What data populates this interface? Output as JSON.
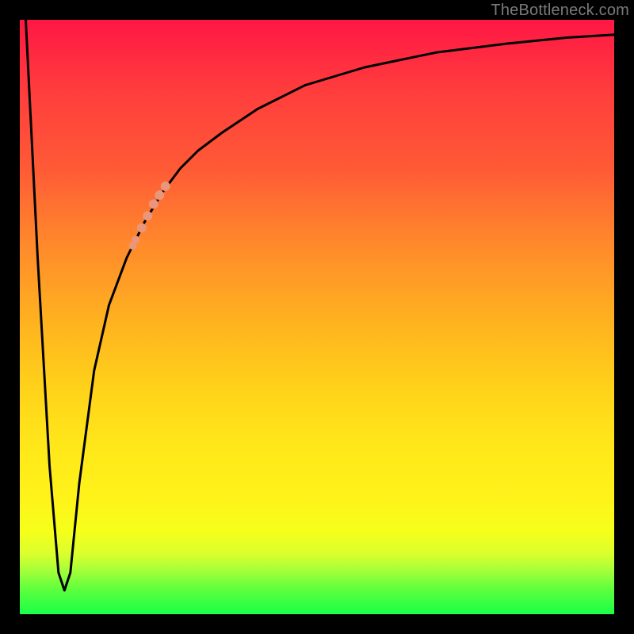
{
  "watermark": "TheBottleneck.com",
  "chart_data": {
    "type": "line",
    "title": "",
    "xlabel": "",
    "ylabel": "",
    "xlim": [
      0,
      100
    ],
    "ylim": [
      0,
      100
    ],
    "grid": false,
    "legend": false,
    "background_gradient_stops": [
      {
        "pos": 0,
        "color": "#ff1744"
      },
      {
        "pos": 12,
        "color": "#ff3d3d"
      },
      {
        "pos": 25,
        "color": "#ff5a36"
      },
      {
        "pos": 38,
        "color": "#ff8a2b"
      },
      {
        "pos": 50,
        "color": "#ffb020"
      },
      {
        "pos": 62,
        "color": "#ffd21a"
      },
      {
        "pos": 72,
        "color": "#ffe81a"
      },
      {
        "pos": 80,
        "color": "#fff21a"
      },
      {
        "pos": 86,
        "color": "#f6ff1a"
      },
      {
        "pos": 90,
        "color": "#d9ff2e"
      },
      {
        "pos": 93,
        "color": "#9dff3a"
      },
      {
        "pos": 96,
        "color": "#5aff3d"
      },
      {
        "pos": 100,
        "color": "#1aff49"
      }
    ],
    "series": [
      {
        "name": "bottleneck-curve",
        "color": "#000000",
        "x": [
          1,
          3,
          5,
          6.5,
          7.5,
          8.5,
          10,
          12.5,
          15,
          18,
          21,
          24,
          27,
          30,
          34,
          40,
          48,
          58,
          70,
          82,
          92,
          100
        ],
        "values": [
          100,
          60,
          25,
          7,
          4,
          7,
          22,
          41,
          52,
          60,
          66,
          71,
          75,
          78,
          81,
          85,
          89,
          92,
          94.5,
          96,
          97,
          97.5
        ]
      }
    ],
    "highlight_points": {
      "name": "highlighted-range",
      "color": "#e9967a",
      "radius_large": 6,
      "radius_small": 5,
      "points": [
        {
          "x": 19.0,
          "y": 62.0,
          "r": "small"
        },
        {
          "x": 19.5,
          "y": 63.0,
          "r": "small"
        },
        {
          "x": 20.5,
          "y": 65.0,
          "r": "large"
        },
        {
          "x": 21.5,
          "y": 67.0,
          "r": "large"
        },
        {
          "x": 22.5,
          "y": 69.0,
          "r": "large"
        },
        {
          "x": 23.5,
          "y": 70.5,
          "r": "large"
        },
        {
          "x": 24.5,
          "y": 72.0,
          "r": "large"
        }
      ]
    }
  }
}
